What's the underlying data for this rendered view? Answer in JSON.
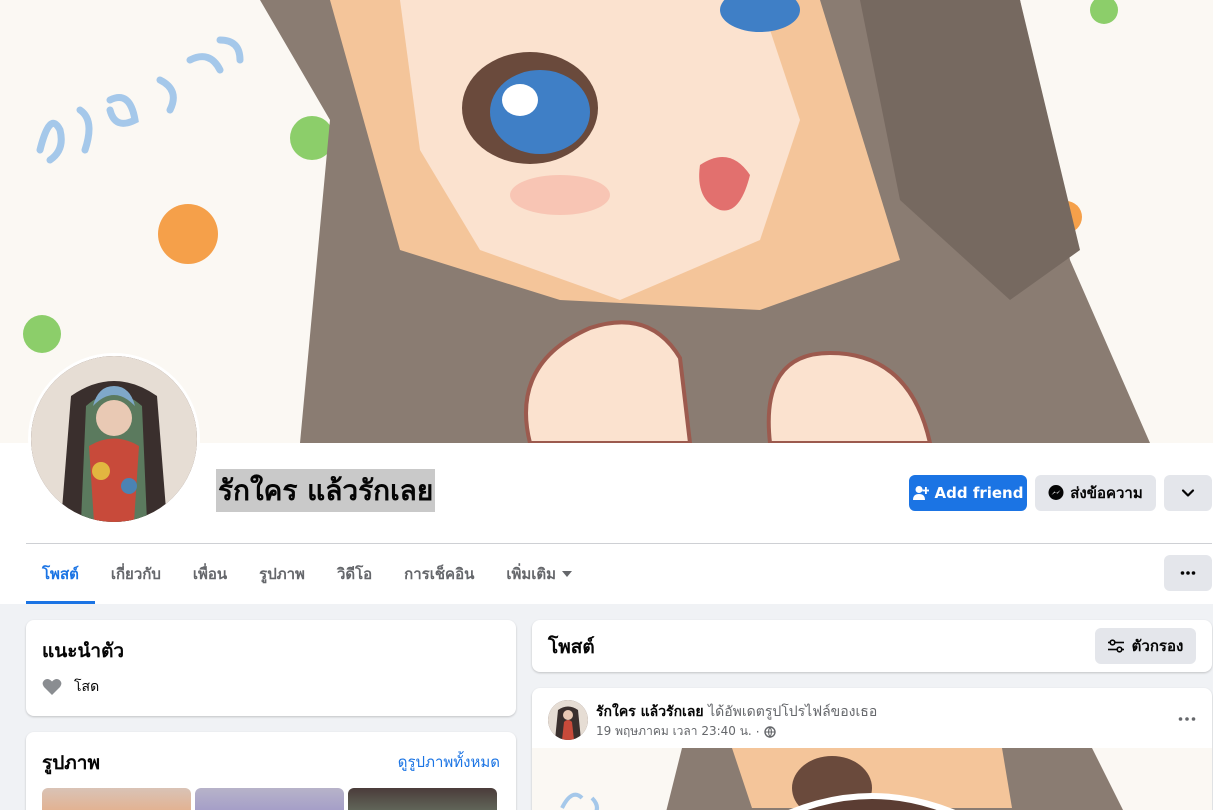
{
  "profile": {
    "name": "รักใคร แล้วรักเลย",
    "add_friend_label": "Add friend",
    "message_label": "ส่งข้อความ"
  },
  "tabs": [
    {
      "label": "โพสต์"
    },
    {
      "label": "เกี่ยวกับ"
    },
    {
      "label": "เพื่อน"
    },
    {
      "label": "รูปภาพ"
    },
    {
      "label": "วิดีโอ"
    },
    {
      "label": "การเช็คอิน"
    },
    {
      "label": "เพิ่มเติม"
    }
  ],
  "intro": {
    "title": "แนะนำตัว",
    "relationship": "โสด"
  },
  "photos": {
    "title": "รูปภาพ",
    "see_all": "ดูรูปภาพทั้งหมด"
  },
  "posts": {
    "title": "โพสต์",
    "filter_label": "ตัวกรอง"
  },
  "post": {
    "author": "รักใคร แล้วรักเลย",
    "action": "ได้อัพเดตรูปโปรไฟล์ของเธอ",
    "date": "19 พฤษภาคม เวลา 23:40 น.",
    "separator": "·"
  },
  "colors": {
    "accent": "#1b74e4",
    "secondary_button": "#e4e6eb",
    "page_background": "#f0f2f5"
  },
  "icons": {
    "add_friend": "person-plus-icon",
    "message": "messenger-icon",
    "chevron": "chevron-down-icon",
    "more": "ellipsis-icon",
    "heart": "heart-icon",
    "filter": "filter-sliders-icon",
    "privacy": "globe-icon"
  }
}
